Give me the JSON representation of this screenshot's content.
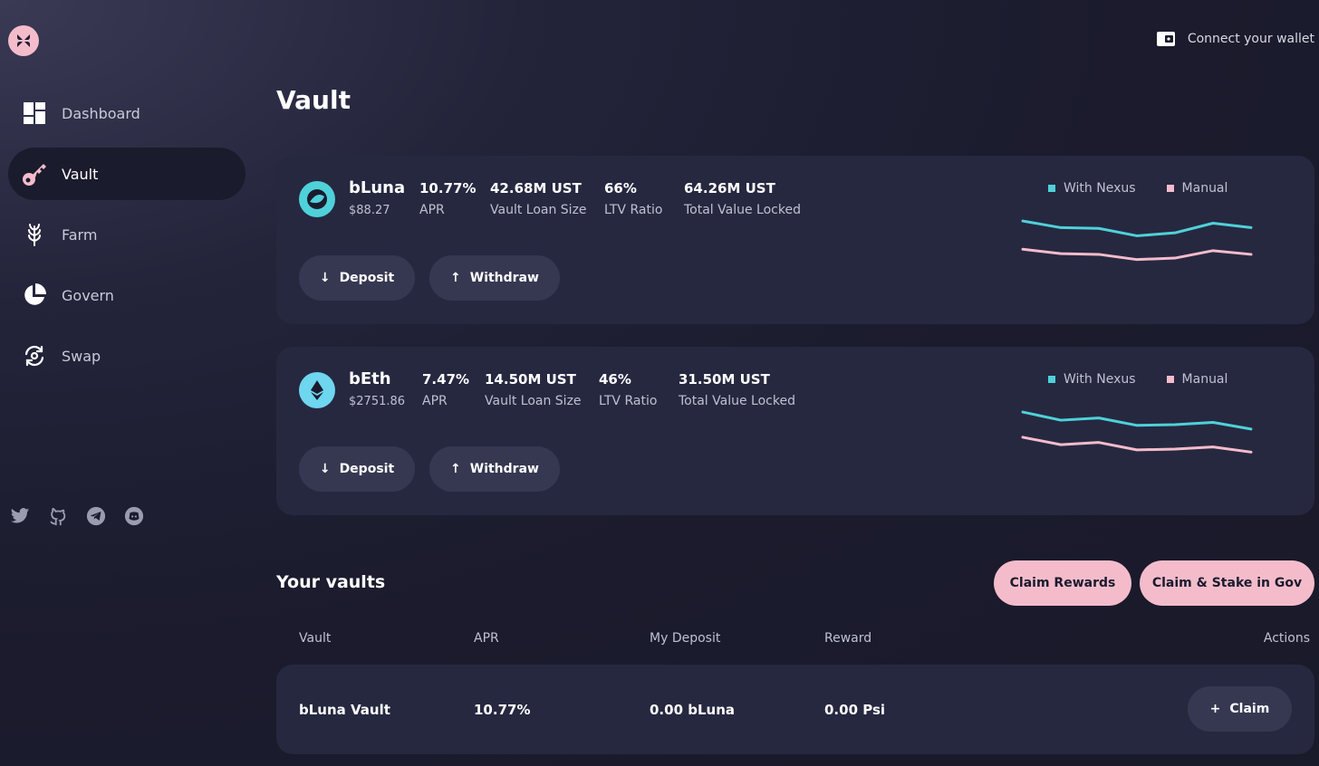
{
  "colors": {
    "accent_pink": "#f4bccb",
    "nexus_line": "#4fd1d9",
    "manual_line": "#f4bccb",
    "card_bg": "#262840"
  },
  "nav": {
    "items": [
      {
        "label": "Dashboard",
        "icon": "dashboard-icon"
      },
      {
        "label": "Vault",
        "icon": "key-icon",
        "active": true
      },
      {
        "label": "Farm",
        "icon": "wheat-icon"
      },
      {
        "label": "Govern",
        "icon": "pie-chart-icon"
      },
      {
        "label": "Swap",
        "icon": "swap-icon"
      }
    ]
  },
  "socials": [
    "twitter-icon",
    "github-icon",
    "telegram-icon",
    "discord-icon"
  ],
  "header": {
    "wallet_label": "Connect your wallet"
  },
  "page": {
    "title": "Vault"
  },
  "vaults": [
    {
      "name": "bLuna",
      "price": "$88.27",
      "stats": [
        {
          "value": "10.77%",
          "label": "APR"
        },
        {
          "value": "42.68M UST",
          "label": "Vault Loan Size"
        },
        {
          "value": "66%",
          "label": "LTV Ratio"
        },
        {
          "value": "64.26M UST",
          "label": "Total Value Locked"
        }
      ],
      "deposit_label": "Deposit",
      "withdraw_label": "Withdraw",
      "legend": [
        "With Nexus",
        "Manual"
      ]
    },
    {
      "name": "bEth",
      "price": "$2751.86",
      "stats": [
        {
          "value": "7.47%",
          "label": "APR"
        },
        {
          "value": "14.50M UST",
          "label": "Vault Loan Size"
        },
        {
          "value": "46%",
          "label": "LTV Ratio"
        },
        {
          "value": "31.50M UST",
          "label": "Total Value Locked"
        }
      ],
      "deposit_label": "Deposit",
      "withdraw_label": "Withdraw",
      "legend": [
        "With Nexus",
        "Manual"
      ]
    }
  ],
  "chart_data": [
    {
      "type": "line",
      "x": [
        1,
        2,
        3,
        4,
        5,
        6,
        7
      ],
      "ylim": [
        0,
        100
      ],
      "series": [
        {
          "name": "With Nexus",
          "values": [
            78,
            69,
            68,
            58,
            62,
            75,
            69
          ]
        },
        {
          "name": "Manual",
          "values": [
            40,
            34,
            33,
            26,
            28,
            38,
            33
          ]
        }
      ]
    },
    {
      "type": "line",
      "x": [
        1,
        2,
        3,
        4,
        5,
        6,
        7
      ],
      "ylim": [
        0,
        100
      ],
      "series": [
        {
          "name": "With Nexus",
          "values": [
            78,
            67,
            70,
            60,
            61,
            64,
            55
          ]
        },
        {
          "name": "Manual",
          "values": [
            44,
            34,
            37,
            27,
            28,
            31,
            24
          ]
        }
      ]
    }
  ],
  "your_vaults": {
    "title": "Your vaults",
    "claim_rewards_label": "Claim Rewards",
    "claim_stake_label": "Claim & Stake in Gov",
    "columns": [
      "Vault",
      "APR",
      "My Deposit",
      "Reward",
      "Actions"
    ],
    "rows": [
      {
        "vault": "bLuna Vault",
        "apr": "10.77%",
        "deposit": "0.00 bLuna",
        "reward": "0.00 Psi",
        "action_label": "Claim"
      }
    ]
  }
}
